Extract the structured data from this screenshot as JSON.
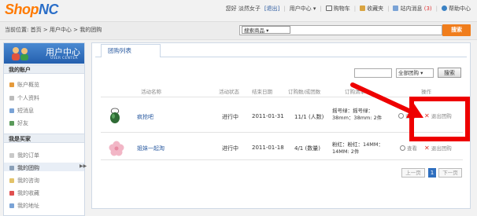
{
  "header": {
    "logo_shop": "Shop",
    "logo_nc": "NC",
    "greeting": "您好 淡然女子",
    "logout": "[退出]",
    "user_center": "用户中心",
    "cart": "购物车",
    "favorites": "收藏夹",
    "messages": "站内消息",
    "messages_count": "(3)",
    "help": "帮助中心"
  },
  "breadcrumb": {
    "label": "当前位置:",
    "home": "首页",
    "user_center": "用户中心",
    "current": "我的团购"
  },
  "search": {
    "category": "搜索商品",
    "button": "搜索"
  },
  "sidebar": {
    "title": "用户中心",
    "subtitle": "USER CENTER",
    "account_header": "我的账户",
    "account_items": [
      {
        "label": "账户概览",
        "icon": "overview-icon"
      },
      {
        "label": "个人资料",
        "icon": "profile-icon"
      },
      {
        "label": "短消息",
        "icon": "message-icon"
      },
      {
        "label": "好友",
        "icon": "friends-icon"
      }
    ],
    "buyer_header": "我是买家",
    "buyer_items": [
      {
        "label": "我的订单",
        "icon": "order-icon"
      },
      {
        "label": "我的团购",
        "icon": "groupbuy-icon"
      },
      {
        "label": "我的咨询",
        "icon": "consult-icon"
      },
      {
        "label": "我的收藏",
        "icon": "favorite-icon"
      },
      {
        "label": "我的地址",
        "icon": "address-icon"
      }
    ]
  },
  "main": {
    "tab": "团购列表",
    "filter_select": "全部团购",
    "filter_button": "搜索",
    "columns": [
      "活动名称",
      "活动状态",
      "结束日期",
      "订购数/成团数",
      "订购清单",
      "操作"
    ],
    "rows": [
      {
        "name": "疯抢吧",
        "status": "进行中",
        "end_date": "2011-01-31",
        "count": "11/1 (人数)",
        "spec_line1": "摇号绿：摇号绿：",
        "spec_line2": "38mm：38mm: 2件",
        "view": "查看",
        "quit": "退出团购"
      },
      {
        "name": "姐妹一起淘",
        "status": "进行中",
        "end_date": "2011-01-18",
        "count": "4/1 (数量)",
        "spec_line1": "粉红：粉红：14MM：",
        "spec_line2": "14MM: 2件",
        "view": "查看",
        "quit": "退出团购"
      }
    ],
    "pager": {
      "prev": "上一页",
      "current": "1",
      "next": "下一页"
    }
  },
  "colors": {
    "brand_orange": "#ff7a00",
    "brand_blue": "#2a6ec8",
    "annotation_red": "#ee0000",
    "search_button": "#f07d1c"
  }
}
